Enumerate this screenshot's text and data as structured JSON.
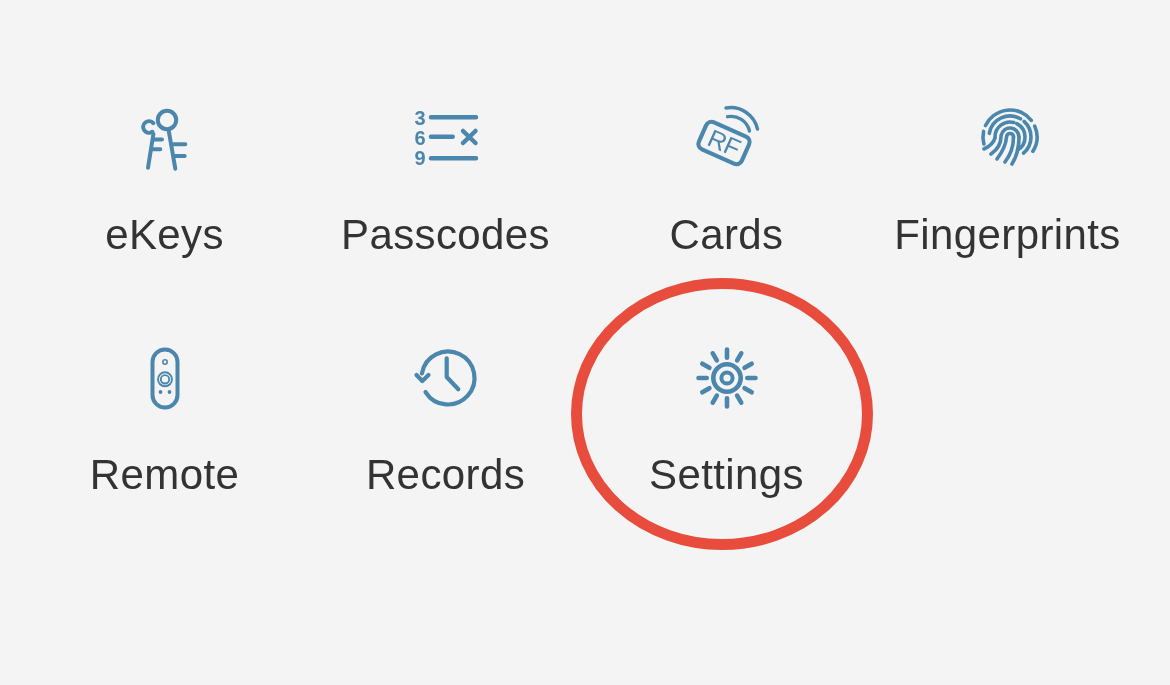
{
  "menu": {
    "items": [
      {
        "label": "eKeys",
        "highlighted": false
      },
      {
        "label": "Passcodes",
        "icon_text": [
          "3",
          "6",
          "9"
        ],
        "highlighted": false
      },
      {
        "label": "Cards",
        "icon_text": [
          "RF"
        ],
        "highlighted": false
      },
      {
        "label": "Fingerprints",
        "highlighted": false
      },
      {
        "label": "Remote",
        "highlighted": false
      },
      {
        "label": "Records",
        "highlighted": false
      },
      {
        "label": "Settings",
        "highlighted": true
      }
    ]
  }
}
